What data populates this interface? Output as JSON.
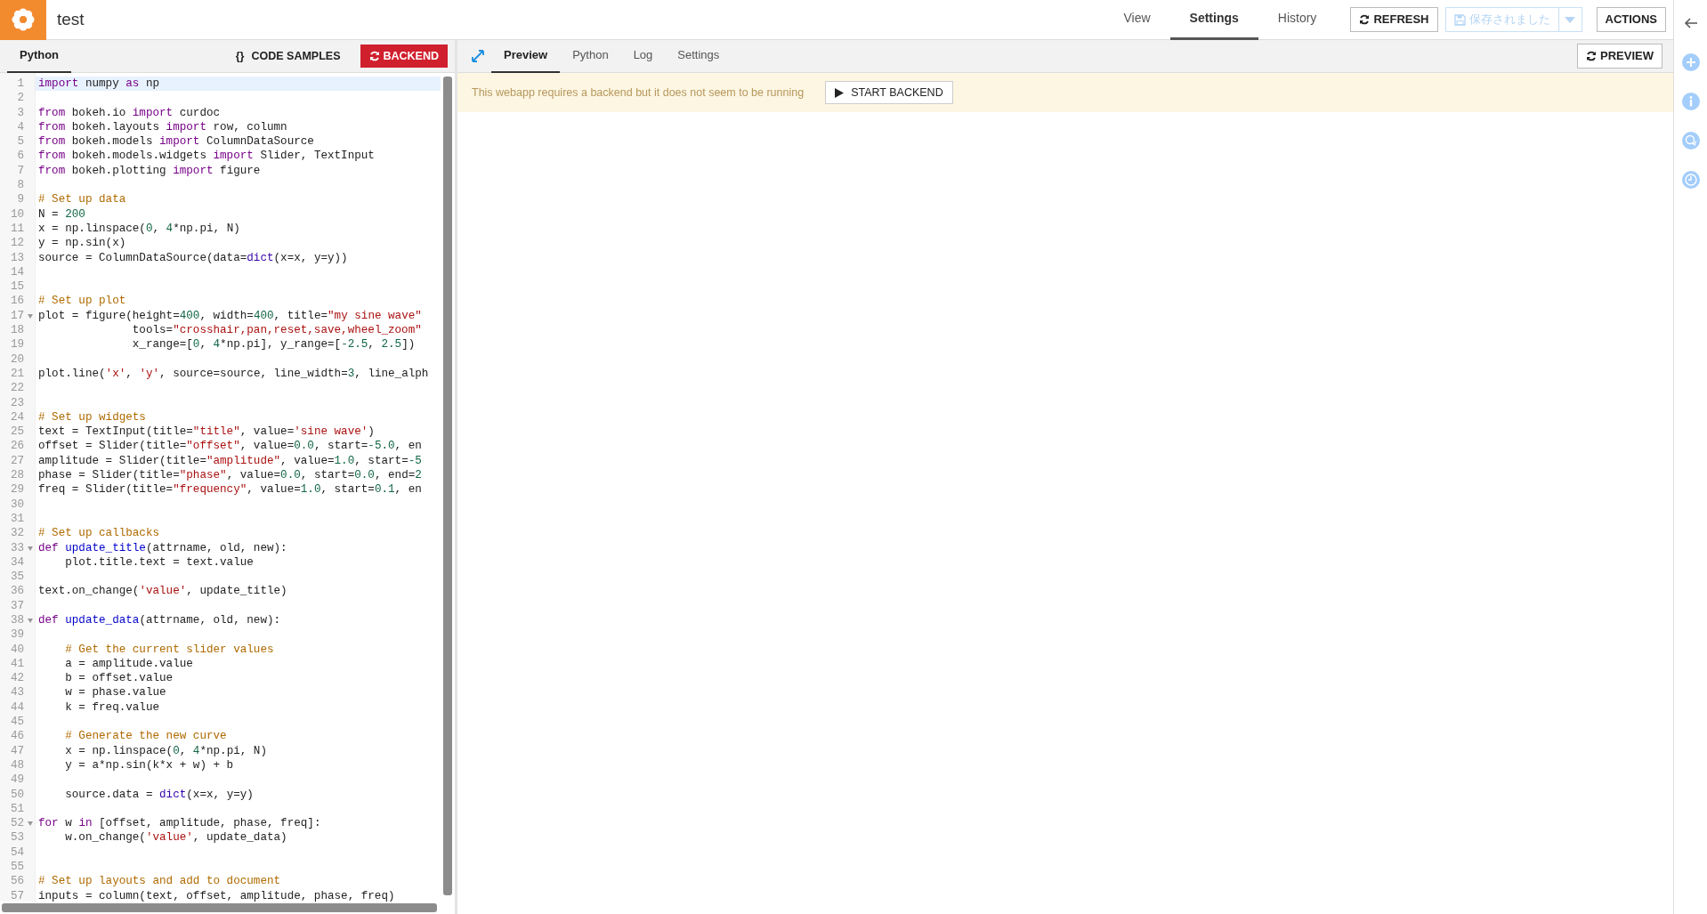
{
  "app_bar": {
    "title": "test",
    "tabs": [
      {
        "label": "View",
        "selected": false
      },
      {
        "label": "Settings",
        "selected": true
      },
      {
        "label": "History",
        "selected": false
      }
    ],
    "refresh_button": "REFRESH",
    "save_button": {
      "label": "保存されました",
      "disabled": true
    },
    "actions_button": "ACTIONS"
  },
  "editor_panel": {
    "tabs": [
      {
        "label": "Python",
        "selected": true
      }
    ],
    "code_samples_button": "CODE SAMPLES",
    "code_samples_glyph": "{}",
    "backend_button": "BACKEND",
    "lines": [
      {
        "number": "1",
        "active": true,
        "fold": false,
        "tokens": [
          {
            "text": "import",
            "kind": "keyword"
          },
          {
            "text": " numpy ",
            "kind": "plain"
          },
          {
            "text": "as",
            "kind": "keyword"
          },
          {
            "text": " np",
            "kind": "plain"
          }
        ]
      },
      {
        "number": "2",
        "active": false,
        "fold": false
      },
      {
        "number": "3",
        "active": false,
        "fold": false,
        "tokens": [
          {
            "text": "from",
            "kind": "keyword"
          },
          {
            "text": " bokeh.io ",
            "kind": "plain"
          },
          {
            "text": "import",
            "kind": "keyword"
          },
          {
            "text": " curdoc",
            "kind": "plain"
          }
        ]
      },
      {
        "number": "4",
        "active": false,
        "fold": false,
        "tokens": [
          {
            "text": "from",
            "kind": "keyword"
          },
          {
            "text": " bokeh.layouts ",
            "kind": "plain"
          },
          {
            "text": "import",
            "kind": "keyword"
          },
          {
            "text": " row, column",
            "kind": "plain"
          }
        ]
      },
      {
        "number": "5",
        "active": false,
        "fold": false,
        "tokens": [
          {
            "text": "from",
            "kind": "keyword"
          },
          {
            "text": " bokeh.models ",
            "kind": "plain"
          },
          {
            "text": "import",
            "kind": "keyword"
          },
          {
            "text": " ColumnDataSource",
            "kind": "plain"
          }
        ]
      },
      {
        "number": "6",
        "active": false,
        "fold": false,
        "tokens": [
          {
            "text": "from",
            "kind": "keyword"
          },
          {
            "text": " bokeh.models.widgets ",
            "kind": "plain"
          },
          {
            "text": "import",
            "kind": "keyword"
          },
          {
            "text": " Slider, TextInput",
            "kind": "plain"
          }
        ]
      },
      {
        "number": "7",
        "active": false,
        "fold": false,
        "tokens": [
          {
            "text": "from",
            "kind": "keyword"
          },
          {
            "text": " bokeh.plotting ",
            "kind": "plain"
          },
          {
            "text": "import",
            "kind": "keyword"
          },
          {
            "text": " figure",
            "kind": "plain"
          }
        ]
      },
      {
        "number": "8",
        "active": false,
        "fold": false
      },
      {
        "number": "9",
        "active": false,
        "fold": false,
        "tokens": [
          {
            "text": "# Set up data",
            "kind": "comment"
          }
        ]
      },
      {
        "number": "10",
        "active": false,
        "fold": false,
        "tokens": [
          {
            "text": "N = ",
            "kind": "plain"
          },
          {
            "text": "200",
            "kind": "number"
          }
        ]
      },
      {
        "number": "11",
        "active": false,
        "fold": false,
        "tokens": [
          {
            "text": "x = np.linspace(",
            "kind": "plain"
          },
          {
            "text": "0",
            "kind": "number"
          },
          {
            "text": ", ",
            "kind": "plain"
          },
          {
            "text": "4",
            "kind": "number"
          },
          {
            "text": "*np.pi, N)",
            "kind": "plain"
          }
        ]
      },
      {
        "number": "12",
        "active": false,
        "fold": false,
        "tokens": [
          {
            "text": "y = np.sin(x)",
            "kind": "plain"
          }
        ]
      },
      {
        "number": "13",
        "active": false,
        "fold": false,
        "tokens": [
          {
            "text": "source = ColumnDataSource(data=",
            "kind": "plain"
          },
          {
            "text": "dict",
            "kind": "builtin"
          },
          {
            "text": "(x=x, y=y))",
            "kind": "plain"
          }
        ]
      },
      {
        "number": "14",
        "active": false,
        "fold": false
      },
      {
        "number": "15",
        "active": false,
        "fold": false
      },
      {
        "number": "16",
        "active": false,
        "fold": false,
        "tokens": [
          {
            "text": "# Set up plot",
            "kind": "comment"
          }
        ]
      },
      {
        "number": "17",
        "active": false,
        "fold": true,
        "tokens": [
          {
            "text": "plot = figure(height=",
            "kind": "plain"
          },
          {
            "text": "400",
            "kind": "number"
          },
          {
            "text": ", width=",
            "kind": "plain"
          },
          {
            "text": "400",
            "kind": "number"
          },
          {
            "text": ", title=",
            "kind": "plain"
          },
          {
            "text": "\"my sine wave\"",
            "kind": "string"
          }
        ]
      },
      {
        "number": "18",
        "active": false,
        "fold": false,
        "tokens": [
          {
            "text": "              tools=",
            "kind": "plain"
          },
          {
            "text": "\"crosshair,pan,reset,save,wheel_zoom\"",
            "kind": "string"
          }
        ]
      },
      {
        "number": "19",
        "active": false,
        "fold": false,
        "tokens": [
          {
            "text": "              x_range=[",
            "kind": "plain"
          },
          {
            "text": "0",
            "kind": "number"
          },
          {
            "text": ", ",
            "kind": "plain"
          },
          {
            "text": "4",
            "kind": "number"
          },
          {
            "text": "*np.pi], y_range=[",
            "kind": "plain"
          },
          {
            "text": "-2.5",
            "kind": "number"
          },
          {
            "text": ", ",
            "kind": "plain"
          },
          {
            "text": "2.5",
            "kind": "number"
          },
          {
            "text": "])",
            "kind": "plain"
          }
        ]
      },
      {
        "number": "20",
        "active": false,
        "fold": false
      },
      {
        "number": "21",
        "active": false,
        "fold": false,
        "tokens": [
          {
            "text": "plot.line(",
            "kind": "plain"
          },
          {
            "text": "'x'",
            "kind": "string"
          },
          {
            "text": ", ",
            "kind": "plain"
          },
          {
            "text": "'y'",
            "kind": "string"
          },
          {
            "text": ", source=source, line_width=",
            "kind": "plain"
          },
          {
            "text": "3",
            "kind": "number"
          },
          {
            "text": ", line_alph",
            "kind": "plain"
          }
        ]
      },
      {
        "number": "22",
        "active": false,
        "fold": false
      },
      {
        "number": "23",
        "active": false,
        "fold": false
      },
      {
        "number": "24",
        "active": false,
        "fold": false,
        "tokens": [
          {
            "text": "# Set up widgets",
            "kind": "comment"
          }
        ]
      },
      {
        "number": "25",
        "active": false,
        "fold": false,
        "tokens": [
          {
            "text": "text = TextInput(title=",
            "kind": "plain"
          },
          {
            "text": "\"title\"",
            "kind": "string"
          },
          {
            "text": ", value=",
            "kind": "plain"
          },
          {
            "text": "'sine wave'",
            "kind": "string"
          },
          {
            "text": ")",
            "kind": "plain"
          }
        ]
      },
      {
        "number": "26",
        "active": false,
        "fold": false,
        "tokens": [
          {
            "text": "offset = Slider(title=",
            "kind": "plain"
          },
          {
            "text": "\"offset\"",
            "kind": "string"
          },
          {
            "text": ", value=",
            "kind": "plain"
          },
          {
            "text": "0.0",
            "kind": "number"
          },
          {
            "text": ", start=",
            "kind": "plain"
          },
          {
            "text": "-5.0",
            "kind": "number"
          },
          {
            "text": ", en",
            "kind": "plain"
          }
        ]
      },
      {
        "number": "27",
        "active": false,
        "fold": false,
        "tokens": [
          {
            "text": "amplitude = Slider(title=",
            "kind": "plain"
          },
          {
            "text": "\"amplitude\"",
            "kind": "string"
          },
          {
            "text": ", value=",
            "kind": "plain"
          },
          {
            "text": "1.0",
            "kind": "number"
          },
          {
            "text": ", start=",
            "kind": "plain"
          },
          {
            "text": "-5",
            "kind": "number"
          }
        ]
      },
      {
        "number": "28",
        "active": false,
        "fold": false,
        "tokens": [
          {
            "text": "phase = Slider(title=",
            "kind": "plain"
          },
          {
            "text": "\"phase\"",
            "kind": "string"
          },
          {
            "text": ", value=",
            "kind": "plain"
          },
          {
            "text": "0.0",
            "kind": "number"
          },
          {
            "text": ", start=",
            "kind": "plain"
          },
          {
            "text": "0.0",
            "kind": "number"
          },
          {
            "text": ", end=",
            "kind": "plain"
          },
          {
            "text": "2",
            "kind": "number"
          }
        ]
      },
      {
        "number": "29",
        "active": false,
        "fold": false,
        "tokens": [
          {
            "text": "freq = Slider(title=",
            "kind": "plain"
          },
          {
            "text": "\"frequency\"",
            "kind": "string"
          },
          {
            "text": ", value=",
            "kind": "plain"
          },
          {
            "text": "1.0",
            "kind": "number"
          },
          {
            "text": ", start=",
            "kind": "plain"
          },
          {
            "text": "0.1",
            "kind": "number"
          },
          {
            "text": ", en",
            "kind": "plain"
          }
        ]
      },
      {
        "number": "30",
        "active": false,
        "fold": false
      },
      {
        "number": "31",
        "active": false,
        "fold": false
      },
      {
        "number": "32",
        "active": false,
        "fold": false,
        "tokens": [
          {
            "text": "# Set up callbacks",
            "kind": "comment"
          }
        ]
      },
      {
        "number": "33",
        "active": false,
        "fold": true,
        "tokens": [
          {
            "text": "def ",
            "kind": "keyword"
          },
          {
            "text": "update_title",
            "kind": "function"
          },
          {
            "text": "(attrname, old, new):",
            "kind": "plain"
          }
        ]
      },
      {
        "number": "34",
        "active": false,
        "fold": false,
        "tokens": [
          {
            "text": "    plot.title.text = text.value",
            "kind": "plain"
          }
        ]
      },
      {
        "number": "35",
        "active": false,
        "fold": false
      },
      {
        "number": "36",
        "active": false,
        "fold": false,
        "tokens": [
          {
            "text": "text.on_change(",
            "kind": "plain"
          },
          {
            "text": "'value'",
            "kind": "string"
          },
          {
            "text": ", update_title)",
            "kind": "plain"
          }
        ]
      },
      {
        "number": "37",
        "active": false,
        "fold": false
      },
      {
        "number": "38",
        "active": false,
        "fold": true,
        "tokens": [
          {
            "text": "def ",
            "kind": "keyword"
          },
          {
            "text": "update_data",
            "kind": "function"
          },
          {
            "text": "(attrname, old, new):",
            "kind": "plain"
          }
        ]
      },
      {
        "number": "39",
        "active": false,
        "fold": false
      },
      {
        "number": "40",
        "active": false,
        "fold": false,
        "tokens": [
          {
            "text": "    # Get the current slider values",
            "kind": "comment"
          }
        ]
      },
      {
        "number": "41",
        "active": false,
        "fold": false,
        "tokens": [
          {
            "text": "    a = amplitude.value",
            "kind": "plain"
          }
        ]
      },
      {
        "number": "42",
        "active": false,
        "fold": false,
        "tokens": [
          {
            "text": "    b = offset.value",
            "kind": "plain"
          }
        ]
      },
      {
        "number": "43",
        "active": false,
        "fold": false,
        "tokens": [
          {
            "text": "    w = phase.value",
            "kind": "plain"
          }
        ]
      },
      {
        "number": "44",
        "active": false,
        "fold": false,
        "tokens": [
          {
            "text": "    k = freq.value",
            "kind": "plain"
          }
        ]
      },
      {
        "number": "45",
        "active": false,
        "fold": false
      },
      {
        "number": "46",
        "active": false,
        "fold": false,
        "tokens": [
          {
            "text": "    # Generate the new curve",
            "kind": "comment"
          }
        ]
      },
      {
        "number": "47",
        "active": false,
        "fold": false,
        "tokens": [
          {
            "text": "    x = np.linspace(",
            "kind": "plain"
          },
          {
            "text": "0",
            "kind": "number"
          },
          {
            "text": ", ",
            "kind": "plain"
          },
          {
            "text": "4",
            "kind": "number"
          },
          {
            "text": "*np.pi, N)",
            "kind": "plain"
          }
        ]
      },
      {
        "number": "48",
        "active": false,
        "fold": false,
        "tokens": [
          {
            "text": "    y = a*np.sin(k*x + w) + b",
            "kind": "plain"
          }
        ]
      },
      {
        "number": "49",
        "active": false,
        "fold": false
      },
      {
        "number": "50",
        "active": false,
        "fold": false,
        "tokens": [
          {
            "text": "    source.data = ",
            "kind": "plain"
          },
          {
            "text": "dict",
            "kind": "builtin"
          },
          {
            "text": "(x=x, y=y)",
            "kind": "plain"
          }
        ]
      },
      {
        "number": "51",
        "active": false,
        "fold": false
      },
      {
        "number": "52",
        "active": false,
        "fold": true,
        "tokens": [
          {
            "text": "for",
            "kind": "keyword"
          },
          {
            "text": " w ",
            "kind": "plain"
          },
          {
            "text": "in",
            "kind": "keyword"
          },
          {
            "text": " [offset, amplitude, phase, freq]:",
            "kind": "plain"
          }
        ]
      },
      {
        "number": "53",
        "active": false,
        "fold": false,
        "tokens": [
          {
            "text": "    w.on_change(",
            "kind": "plain"
          },
          {
            "text": "'value'",
            "kind": "string"
          },
          {
            "text": ", update_data)",
            "kind": "plain"
          }
        ]
      },
      {
        "number": "54",
        "active": false,
        "fold": false
      },
      {
        "number": "55",
        "active": false,
        "fold": false
      },
      {
        "number": "56",
        "active": false,
        "fold": false,
        "tokens": [
          {
            "text": "# Set up layouts and add to document",
            "kind": "comment"
          }
        ]
      },
      {
        "number": "57",
        "active": false,
        "fold": false,
        "tokens": [
          {
            "text": "inputs = column(text, offset, amplitude, phase, freq)",
            "kind": "plain"
          }
        ]
      }
    ]
  },
  "preview_panel": {
    "tabs": [
      {
        "label": "Preview",
        "selected": true
      },
      {
        "label": "Python",
        "selected": false
      },
      {
        "label": "Log",
        "selected": false
      },
      {
        "label": "Settings",
        "selected": false
      }
    ],
    "preview_button": "PREVIEW",
    "banner": {
      "message": "This webapp requires a backend but it does not seem to be running",
      "button": "START BACKEND"
    }
  }
}
